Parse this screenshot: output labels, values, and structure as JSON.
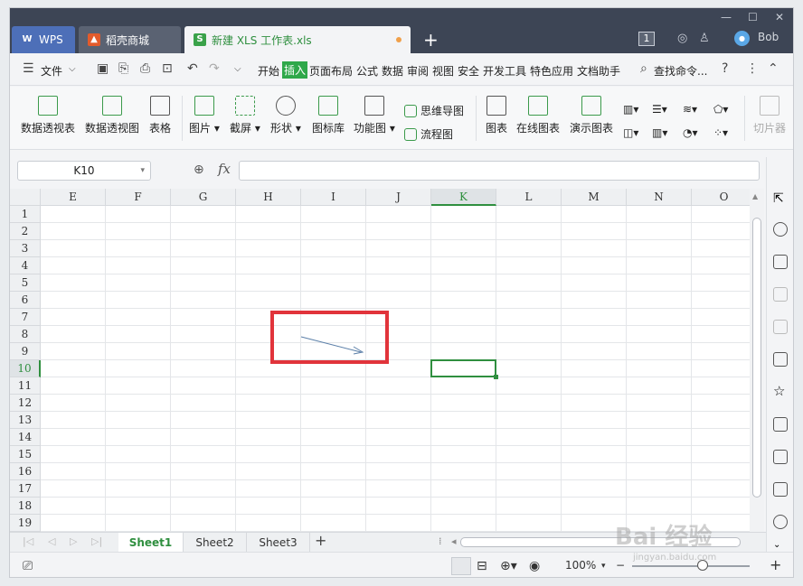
{
  "tabs": {
    "wps": "WPS",
    "shell": "稻壳商城",
    "doc": "新建 XLS 工作表.xls",
    "add": "+"
  },
  "window_controls": [
    "—",
    "☐",
    "✕"
  ],
  "titlebar": {
    "badge": "1",
    "avatar_text": "Bob",
    "user": "Bob"
  },
  "menubar": {
    "file": "文件",
    "items": [
      "开始",
      "插入",
      "页面布局",
      "公式",
      "数据",
      "审阅",
      "视图",
      "安全",
      "开发工具",
      "特色应用",
      "文档助手"
    ],
    "active": "插入",
    "search": "查找命令..."
  },
  "ribbon": {
    "pivot_table": "数据透视表",
    "pivot_chart": "数据透视图",
    "table": "表格",
    "picture": "图片",
    "screenshot": "截屏",
    "shape": "形状",
    "icon_lib": "图标库",
    "func_chart": "功能图",
    "mind_map": "思维导图",
    "flow_chart": "流程图",
    "chart": "图表",
    "online_chart": "在线图表",
    "demo_chart": "演示图表",
    "slicer": "切片器"
  },
  "formula": {
    "cell_ref": "K10",
    "fx": "fx",
    "value": ""
  },
  "grid": {
    "columns": [
      "E",
      "F",
      "G",
      "H",
      "I",
      "J",
      "K",
      "L",
      "M",
      "N",
      "O"
    ],
    "selected_col": "K",
    "rows": [
      "1",
      "2",
      "3",
      "4",
      "5",
      "6",
      "7",
      "8",
      "9",
      "10",
      "11",
      "12",
      "13",
      "14",
      "15",
      "16",
      "17",
      "18",
      "19"
    ],
    "selected_row": "10"
  },
  "sheets": [
    "Sheet1",
    "Sheet2",
    "Sheet3"
  ],
  "active_sheet": "Sheet1",
  "status": {
    "zoom": "100%",
    "minus": "−",
    "plus": "+"
  },
  "watermark": {
    "text": "Bai 经验",
    "sub": "jingyan.baidu.com"
  },
  "colors": {
    "accent": "#2f8f3f",
    "highlight_box": "#e1343b",
    "titlebar": "#3d4555"
  }
}
